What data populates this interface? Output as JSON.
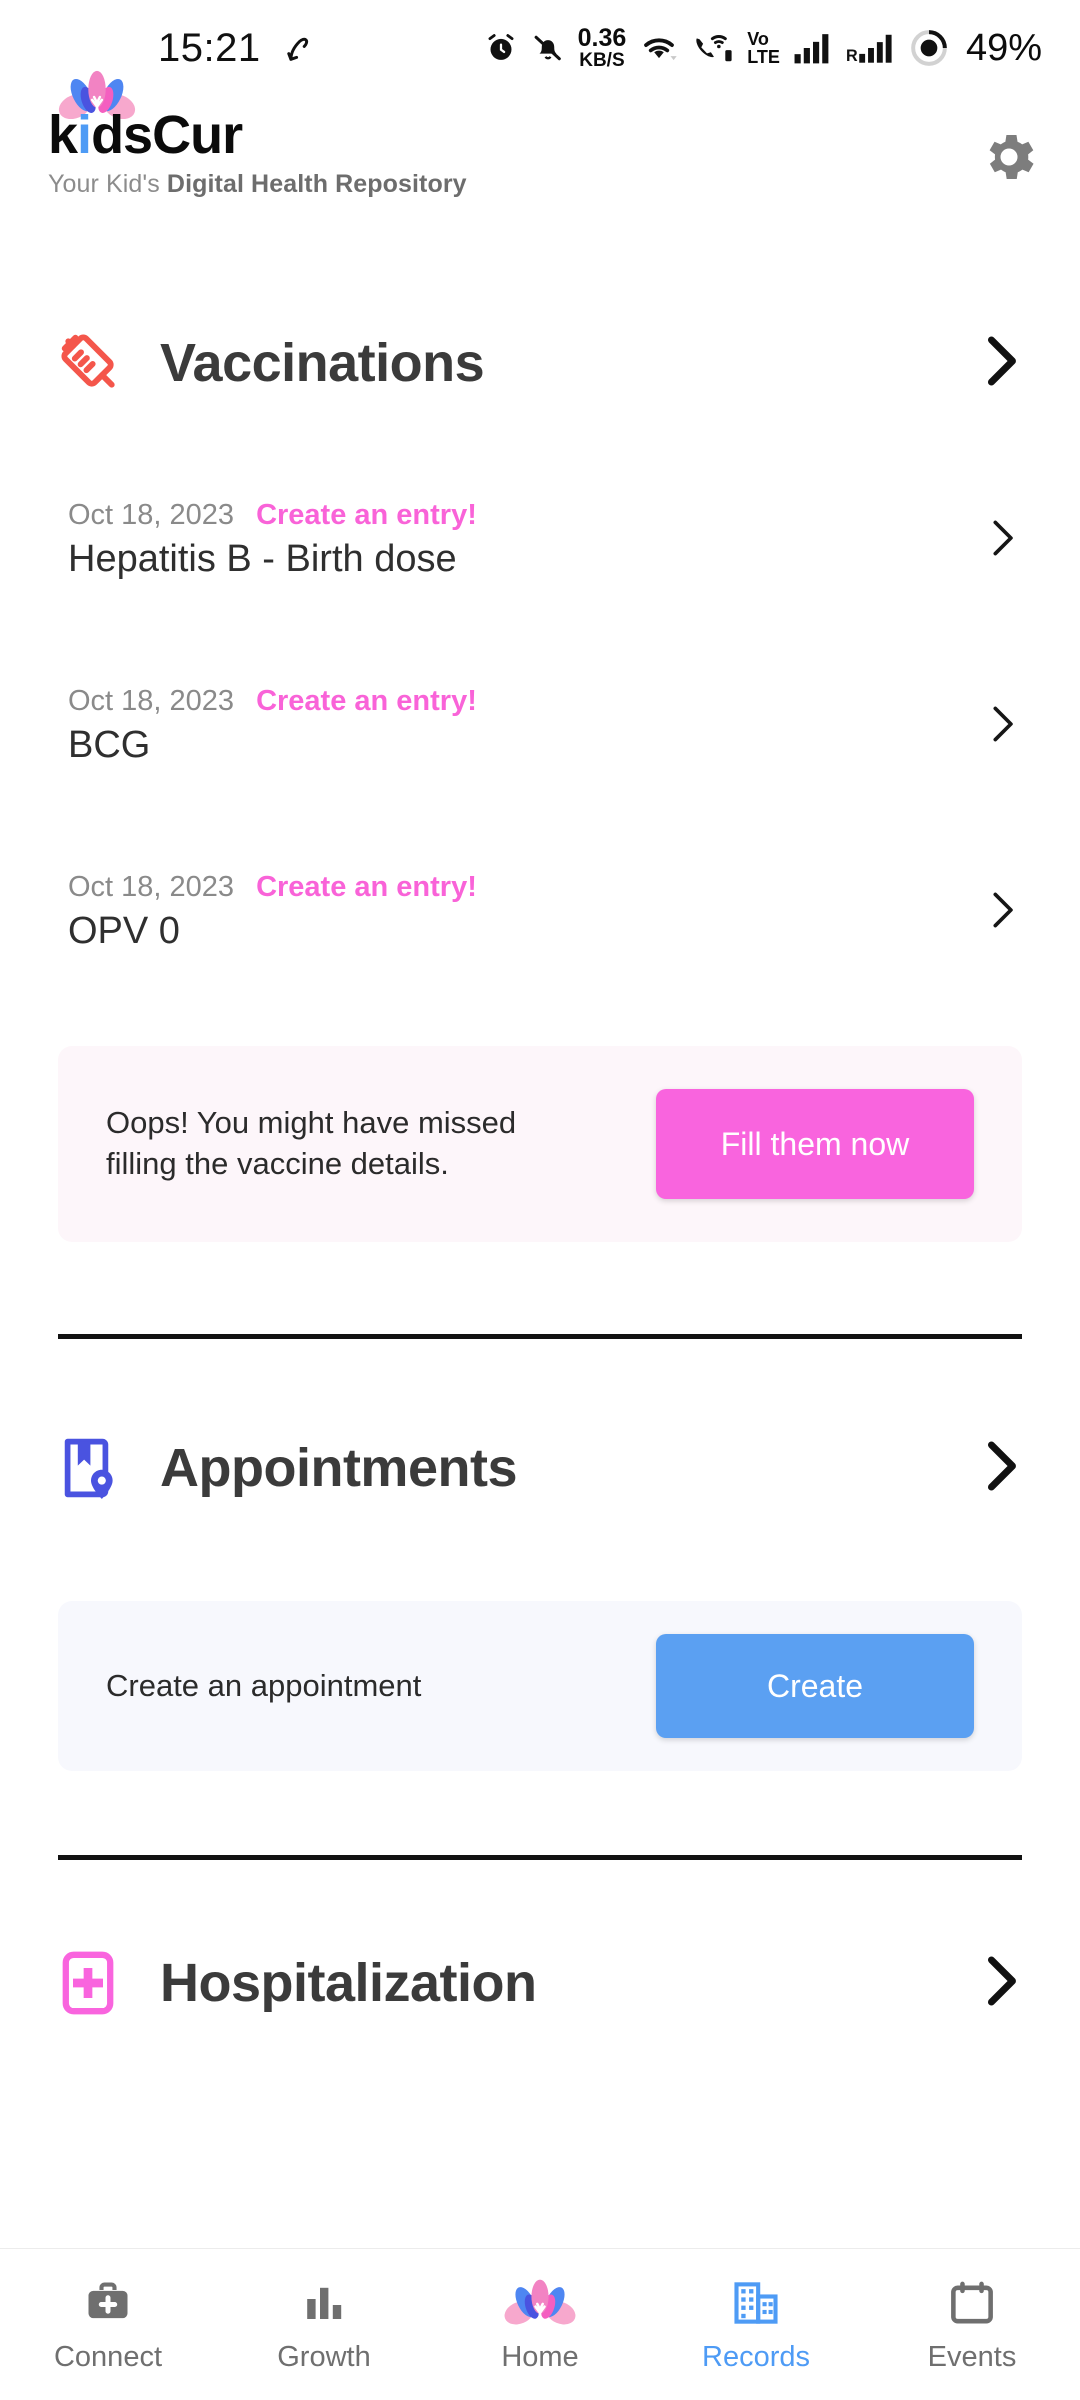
{
  "status_bar": {
    "time": "15:21",
    "network_speed_value": "0.36",
    "network_speed_unit": "KB/S",
    "volte_line1": "Vo",
    "volte_line2": "LTE",
    "roaming_label": "R",
    "battery": "49%",
    "icons": [
      "location-arrow-icon",
      "alarm-icon",
      "bell-muted-icon",
      "wifi-icon",
      "call-wifi-icon",
      "volte-icon",
      "signal-bars-icon",
      "roaming-signal-icon",
      "battery-icon"
    ]
  },
  "app_header": {
    "brand_part1": "k",
    "brand_part_i": "i",
    "brand_part2": "dsCur",
    "tagline_light": "Your Kid's ",
    "tagline_bold": "Digital Health Repository",
    "settings_icon": "gear-icon"
  },
  "sections": {
    "vaccinations": {
      "title": "Vaccinations",
      "icon": "syringe-icon",
      "icon_color": "#f4564b",
      "chevron": "chevron-right-icon",
      "entries": [
        {
          "date": "Oct 18, 2023",
          "cta": "Create an entry!",
          "name": "Hepatitis B - Birth dose"
        },
        {
          "date": "Oct 18, 2023",
          "cta": "Create an entry!",
          "name": "BCG"
        },
        {
          "date": "Oct 18, 2023",
          "cta": "Create an entry!",
          "name": "OPV 0"
        }
      ],
      "alert": {
        "message": "Oops! You might have missed filling the vaccine details.",
        "button_label": "Fill them now",
        "button_color": "#f964de",
        "background": "#fdf6fa"
      }
    },
    "appointments": {
      "title": "Appointments",
      "icon": "book-location-icon",
      "icon_color": "#4a53e0",
      "chevron": "chevron-right-icon",
      "prompt": {
        "message": "Create an appointment",
        "button_label": "Create",
        "button_color": "#5ba0f2",
        "background": "#f7f8fd"
      }
    },
    "hospitalization": {
      "title": "Hospitalization",
      "icon": "hospital-plus-icon",
      "icon_color": "#f964de",
      "chevron": "chevron-right-icon"
    }
  },
  "bottom_nav": {
    "active": "Records",
    "items": [
      {
        "label": "Connect",
        "icon": "medical-bag-icon"
      },
      {
        "label": "Growth",
        "icon": "bar-chart-icon"
      },
      {
        "label": "Home",
        "icon": "lotus-icon"
      },
      {
        "label": "Records",
        "icon": "hospital-building-icon"
      },
      {
        "label": "Events",
        "icon": "calendar-icon"
      }
    ]
  },
  "colors": {
    "accent_pink": "#f964de",
    "accent_blue": "#4e9bf5",
    "vaccine_red": "#f4564b",
    "appointment_indigo": "#4a53e0",
    "text_dark": "#2f2f2f",
    "text_muted": "#8a8a8a"
  }
}
